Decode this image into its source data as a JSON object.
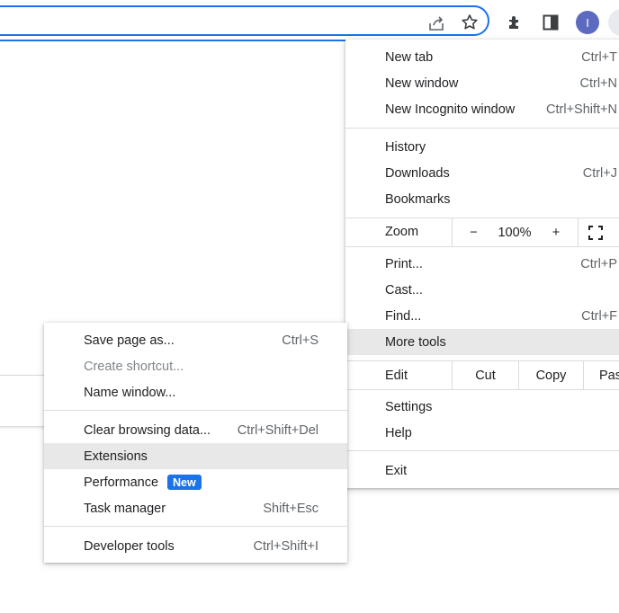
{
  "toolbar": {
    "icons": [
      "share-icon",
      "bookmark-star-icon",
      "extensions-puzzle-icon",
      "side-panel-icon"
    ],
    "avatar_initial": "I"
  },
  "main_menu": {
    "items": {
      "new_tab": {
        "label": "New tab",
        "shortcut": "Ctrl+T"
      },
      "new_window": {
        "label": "New window",
        "shortcut": "Ctrl+N"
      },
      "new_incognito": {
        "label": "New Incognito window",
        "shortcut": "Ctrl+Shift+N"
      },
      "history": {
        "label": "History"
      },
      "downloads": {
        "label": "Downloads",
        "shortcut": "Ctrl+J"
      },
      "bookmarks": {
        "label": "Bookmarks"
      },
      "print": {
        "label": "Print...",
        "shortcut": "Ctrl+P"
      },
      "cast": {
        "label": "Cast..."
      },
      "find": {
        "label": "Find...",
        "shortcut": "Ctrl+F"
      },
      "more_tools": {
        "label": "More tools"
      },
      "settings": {
        "label": "Settings"
      },
      "help": {
        "label": "Help"
      },
      "exit": {
        "label": "Exit"
      }
    },
    "zoom": {
      "label": "Zoom",
      "minus": "−",
      "value": "100%",
      "plus": "+"
    },
    "edit": {
      "label": "Edit",
      "cut": "Cut",
      "copy": "Copy",
      "paste": "Pas"
    }
  },
  "sub_menu": {
    "items": {
      "save_page": {
        "label": "Save page as...",
        "shortcut": "Ctrl+S"
      },
      "create_shortcut": {
        "label": "Create shortcut..."
      },
      "name_window": {
        "label": "Name window..."
      },
      "clear_browsing": {
        "label": "Clear browsing data...",
        "shortcut": "Ctrl+Shift+Del"
      },
      "extensions": {
        "label": "Extensions"
      },
      "performance": {
        "label": "Performance",
        "badge": "New"
      },
      "task_manager": {
        "label": "Task manager",
        "shortcut": "Shift+Esc"
      },
      "developer_tools": {
        "label": "Developer tools",
        "shortcut": "Ctrl+Shift+I"
      }
    }
  },
  "colors": {
    "accent": "#1a73e8",
    "highlight": "#e8e8e8",
    "avatar": "#5c6bc0"
  }
}
